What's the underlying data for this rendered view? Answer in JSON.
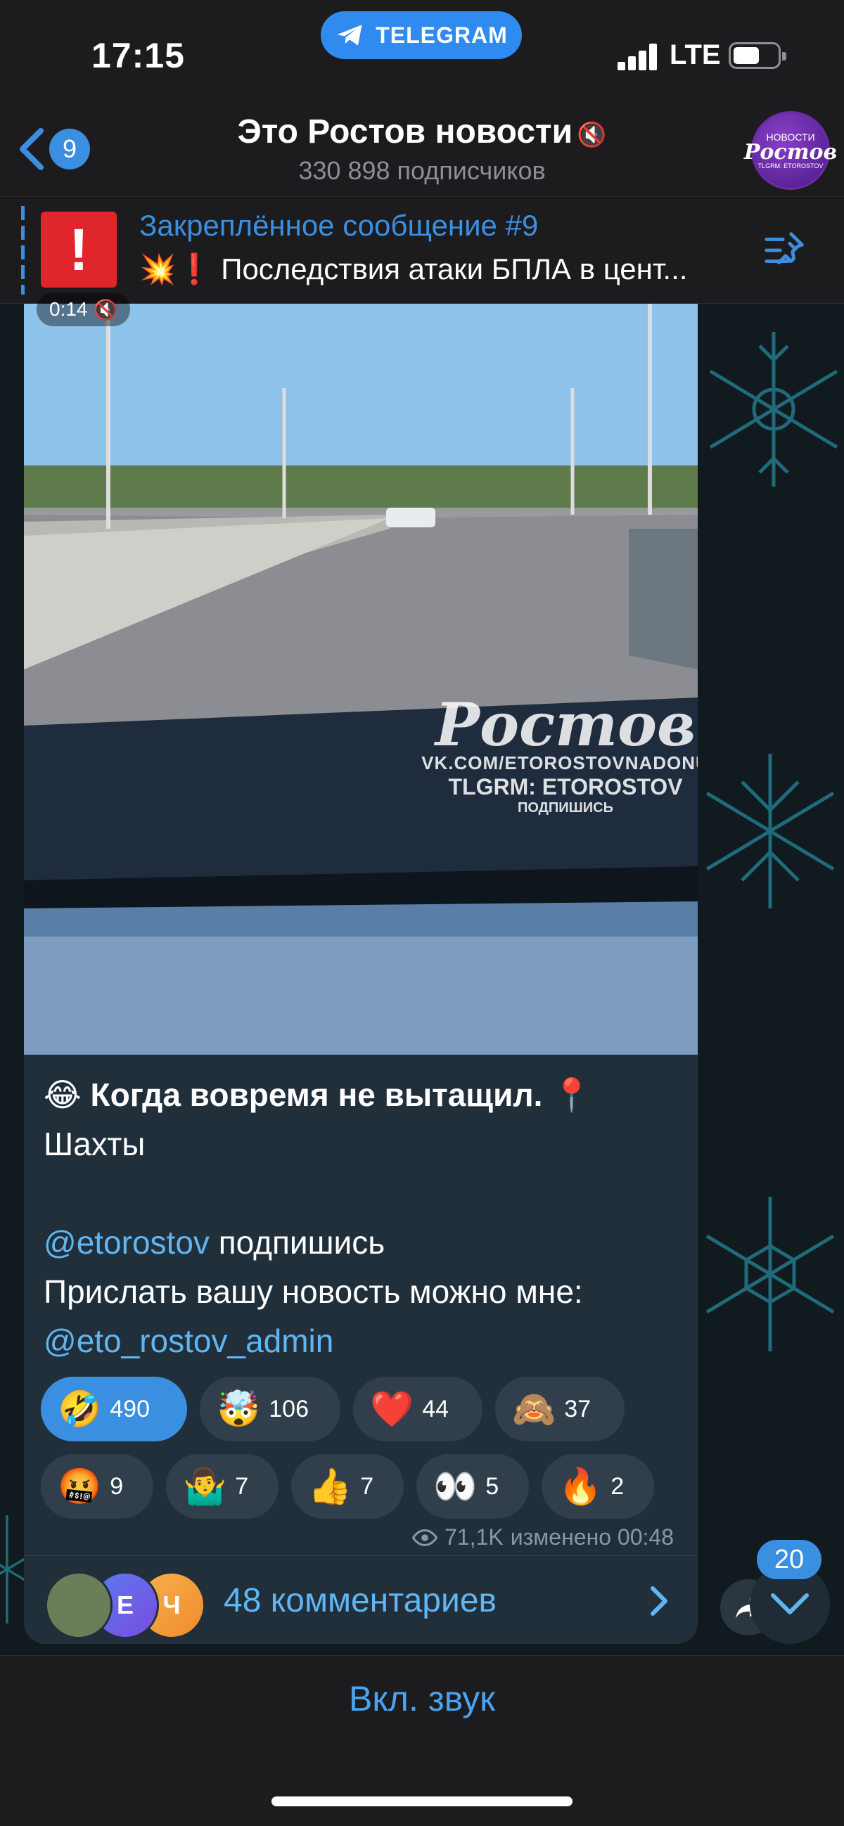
{
  "status_bar": {
    "time": "17:15",
    "app_pill_label": "TELEGRAM",
    "network": "LTE"
  },
  "header": {
    "back_badge": "9",
    "title": "Это Ростов новости",
    "subtitle": "330 898 подписчиков",
    "avatar_text_top": "НОВОСТИ",
    "avatar_text_main": "Ростов",
    "avatar_text_bottom": "TLGRM: ETOROSTOV"
  },
  "pinned": {
    "title": "Закреплённое сообщение #9",
    "text": "💥❗ Последствия атаки БПЛА в цент...",
    "thumb_glyph": "!"
  },
  "video": {
    "duration": "0:14",
    "muted_icon": "🔇",
    "watermark_logo": "Ростов",
    "watermark_vk": "VK.COM/ETOROSTOVNADONU",
    "watermark_tg": "TLGRM: ETOROSTOV",
    "watermark_sub": "ПОДПИШИСЬ"
  },
  "message": {
    "line1_emoji": "😂",
    "line1_bold": "Когда вовремя не вытащил.",
    "line1_pin": "📍",
    "line2": "Шахты",
    "mention1": "@etorostov",
    "mention1_after": " подпишись",
    "line4": "Прислать вашу новость можно мне:",
    "mention2": "@eto_rostov_admin"
  },
  "reactions": [
    {
      "emoji": "🤣",
      "count": "490",
      "active": true
    },
    {
      "emoji": "🤯",
      "count": "106",
      "active": false
    },
    {
      "emoji": "❤️",
      "count": "44",
      "active": false
    },
    {
      "emoji": "🙈",
      "count": "37",
      "active": false
    },
    {
      "emoji": "🤬",
      "count": "9",
      "active": false
    },
    {
      "emoji": "🤷‍♂️",
      "count": "7",
      "active": false
    },
    {
      "emoji": "👍",
      "count": "7",
      "active": false
    },
    {
      "emoji": "👀",
      "count": "5",
      "active": false
    },
    {
      "emoji": "🔥",
      "count": "2",
      "active": false
    }
  ],
  "meta": {
    "views": "71,1K",
    "edited": "изменено 00:48"
  },
  "comments": {
    "label": "48 комментариев",
    "avatars": [
      "",
      "Е",
      "Ч"
    ]
  },
  "scroll_badge": "20",
  "bottom": {
    "sound_button": "Вкл. звук"
  },
  "colors": {
    "accent": "#3b8fe0",
    "link": "#5fb6f3",
    "bubble": "#212f3b",
    "bar": "#1c1c1e"
  }
}
